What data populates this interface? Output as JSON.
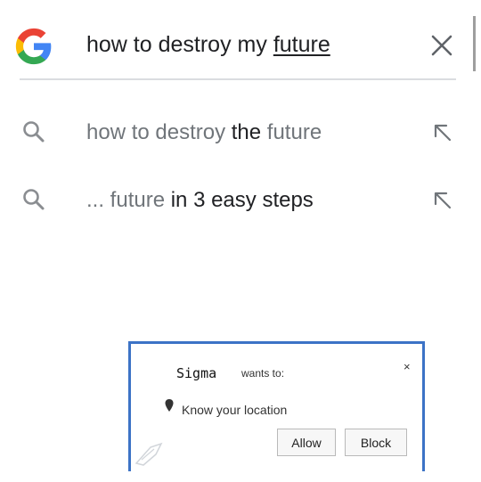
{
  "search": {
    "query_prefix": "how to destroy my ",
    "query_underlined": "future",
    "clear_icon": "close-icon",
    "logo": "google-g-logo"
  },
  "suggestions": [
    {
      "icon": "search-icon",
      "parts": [
        {
          "text": "how to destroy ",
          "style": "light"
        },
        {
          "text": "the",
          "style": "bold"
        },
        {
          "text": " future",
          "style": "light"
        }
      ],
      "fill_icon": "arrow-up-left-icon"
    },
    {
      "icon": "search-icon",
      "parts": [
        {
          "text": "... future ",
          "style": "light"
        },
        {
          "text": "in 3 easy steps",
          "style": "bold"
        }
      ],
      "fill_icon": "arrow-up-left-icon"
    }
  ],
  "popup": {
    "site": "Sigma",
    "wants_to": "wants to:",
    "close": "×",
    "permission": "Know your location",
    "allow_label": "Allow",
    "block_label": "Block",
    "border_color": "#3c73c6"
  },
  "colors": {
    "google_blue": "#4285F4",
    "google_red": "#EA4335",
    "google_yellow": "#FBBC05",
    "google_green": "#34A853",
    "text_dark": "#202124",
    "text_light": "#70757a"
  }
}
